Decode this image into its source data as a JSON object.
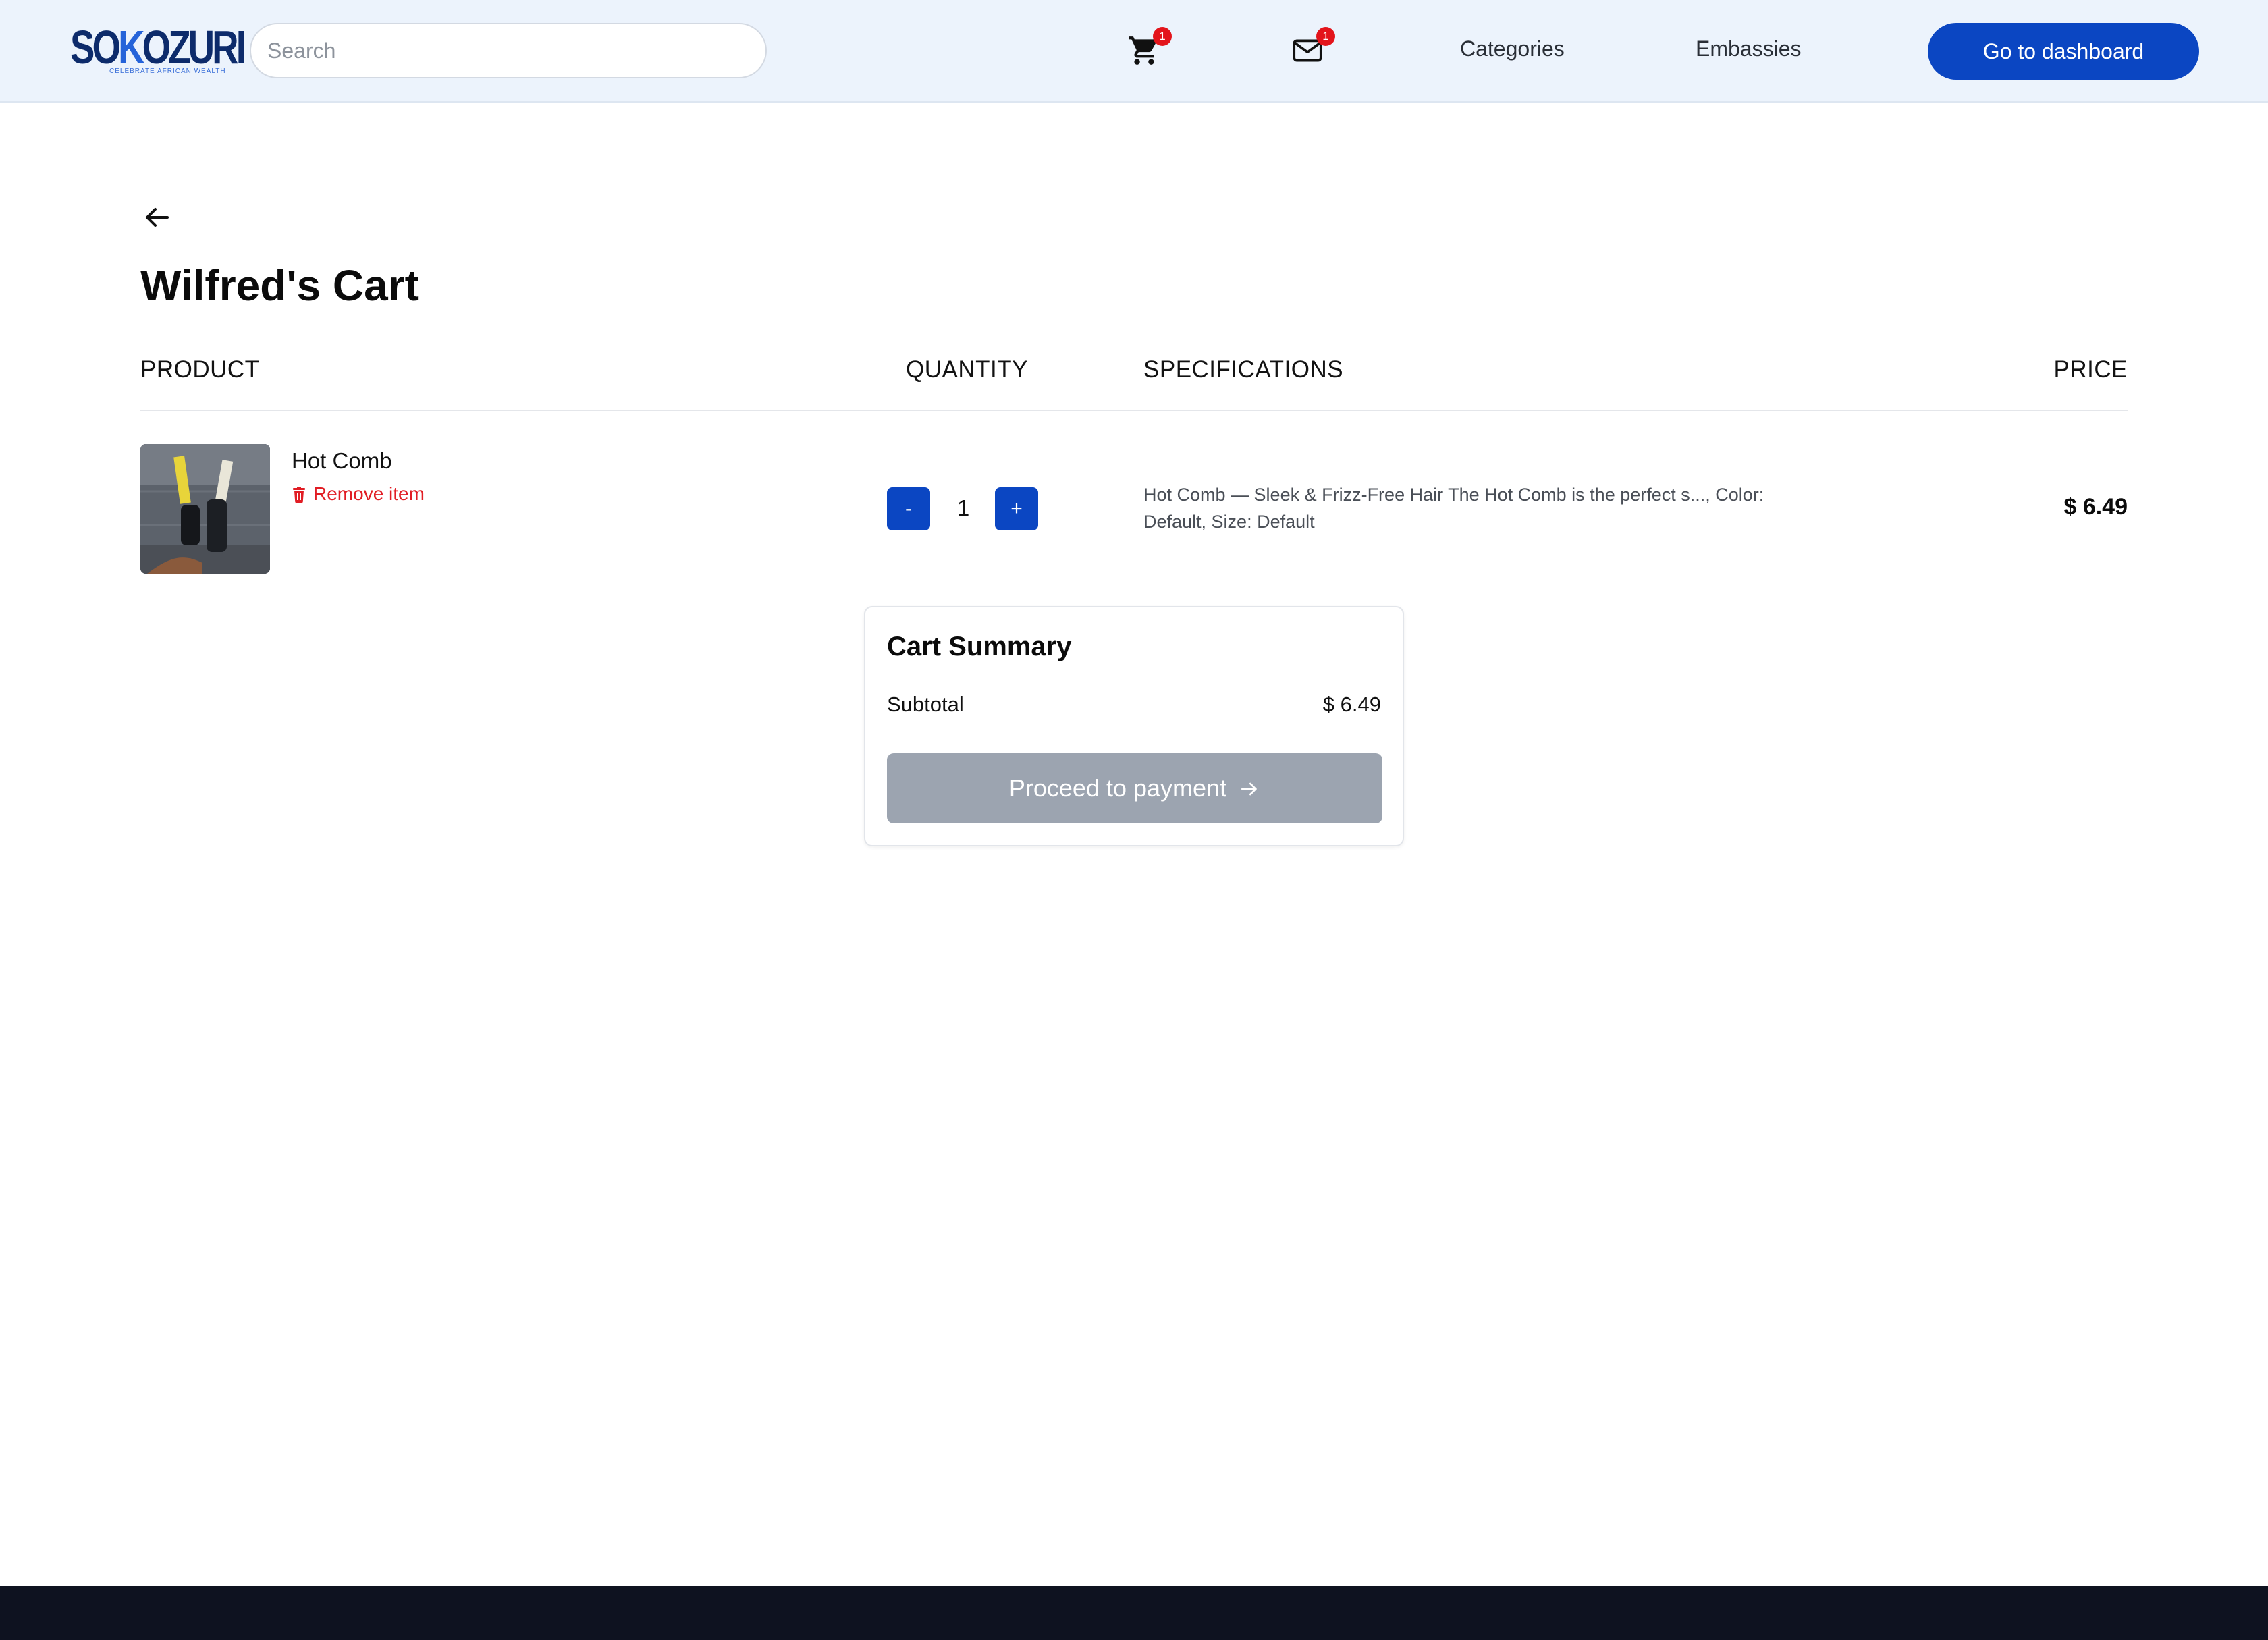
{
  "header": {
    "logo": {
      "word_prefix": "SO",
      "word_k": "K",
      "word_suffix": "OZURI",
      "tagline": "CELEBRATE AFRICAN WEALTH"
    },
    "search": {
      "placeholder": "Search",
      "value": ""
    },
    "cart": {
      "icon": "cart-icon",
      "badge": "1"
    },
    "messages": {
      "icon": "mail-icon",
      "badge": "1"
    },
    "nav": {
      "categories": "Categories",
      "embassies": "Embassies"
    },
    "dashboard_button": "Go to dashboard"
  },
  "page": {
    "back_icon": "arrow-left-icon",
    "title": "Wilfred's Cart"
  },
  "table": {
    "headers": {
      "product": "PRODUCT",
      "quantity": "QUANTITY",
      "specifications": "SPECIFICATIONS",
      "price": "PRICE"
    },
    "rows": [
      {
        "product_name": "Hot Comb",
        "remove_label": "Remove item",
        "remove_icon": "trash-icon",
        "decrement_label": "-",
        "quantity": "1",
        "increment_label": "+",
        "specifications": "Hot Comb — Sleek & Frizz-Free Hair The Hot Comb is the perfect s..., Color: Default, Size: Default",
        "price": "$ 6.49"
      }
    ]
  },
  "summary": {
    "title": "Cart Summary",
    "subtotal_label": "Subtotal",
    "subtotal_value": "$ 6.49",
    "pay_button": "Proceed to payment",
    "pay_icon": "arrow-right-icon"
  },
  "colors": {
    "header_bg": "#ecf3fc",
    "primary": "#0b46c2",
    "danger": "#e11d24",
    "disabled_button": "#9ca4b0",
    "footer_bg": "#0e1220"
  }
}
